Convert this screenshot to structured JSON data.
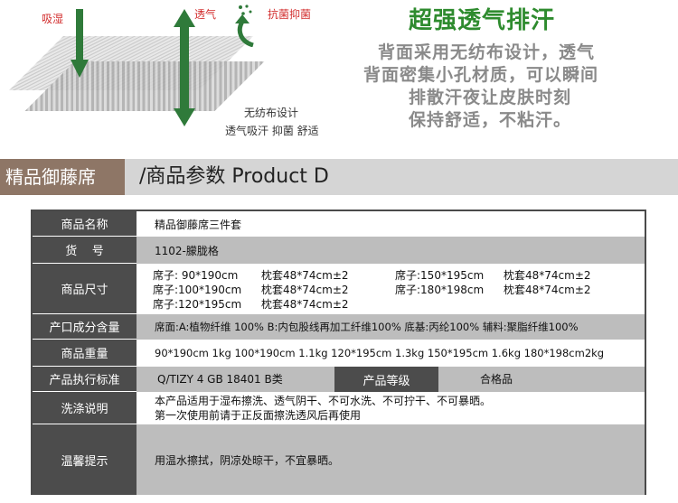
{
  "hero": {
    "labels": {
      "absorb": "吸湿",
      "breath": "透气",
      "antibac": "抗菌抑菌",
      "nonwoven": "无纺布设计",
      "feature": "透气吸汗 抑菌 舒适"
    },
    "title": "超强透气排汗",
    "lines": [
      "背面采用无纺布设计，透气",
      "背面密集小孔材质，可以瞬间",
      "排散汗夜让皮肤时刻",
      "保持舒适，不粘汗。"
    ],
    "colors": {
      "title": "#2e8b2e",
      "arrow": "#2f7a3a",
      "accent_red": "#d22c2c"
    }
  },
  "banner": {
    "left": "精品御藤席",
    "right": "/商品参数 Product D",
    "colors": {
      "left_bg": "#8e7666",
      "bar_bg": "#d5d5d5"
    }
  },
  "spec": {
    "name": {
      "label": "商品名称",
      "value": "精品御藤席三件套"
    },
    "code": {
      "label": "货    号",
      "value": "1102-朦胧格"
    },
    "size": {
      "label": "商品尺寸",
      "items": [
        {
          "mat": "席子: 90*190cm",
          "pillow": "枕套48*74cm±2"
        },
        {
          "mat": "席子:150*195cm",
          "pillow": "枕套48*74cm±2"
        },
        {
          "mat": "席子:100*190cm",
          "pillow": "枕套48*74cm±2"
        },
        {
          "mat": "席子:180*198cm",
          "pillow": "枕套48*74cm±2"
        },
        {
          "mat": "席子:120*195cm",
          "pillow": "枕套48*74cm±2"
        }
      ]
    },
    "composition": {
      "label": "产口成分含量",
      "value": "席面:A:植物纤维 100%  B:内包股线再加工纤维100%   底基:丙纶100%  辅料:聚脂纤维100%"
    },
    "weight": {
      "label": "商品重量",
      "value": "90*190cm  1kg  100*190cm 1.1kg   120*195cm 1.3kg   150*195cm 1.6kg 180*198cm2kg"
    },
    "standard": {
      "label": "产品执行标准",
      "value": "Q/TIZY 4 GB 18401 B类",
      "grade_label": "产品等级",
      "grade_value": "合格品"
    },
    "wash": {
      "label": "洗涤说明",
      "lines": [
        "本产品适用于湿布擦洗、透气阴干、不可水洗、不可拧干、不可暴晒。",
        "第一次使用前请于正反面擦洗透风后再使用"
      ]
    },
    "tip": {
      "label": "温馨提示",
      "value": "用温水擦拭，阴凉处晾干，不宜暴晒。"
    },
    "colors": {
      "head_bg": "#4c4c4c",
      "row_gray": "#bdbdbd"
    }
  }
}
